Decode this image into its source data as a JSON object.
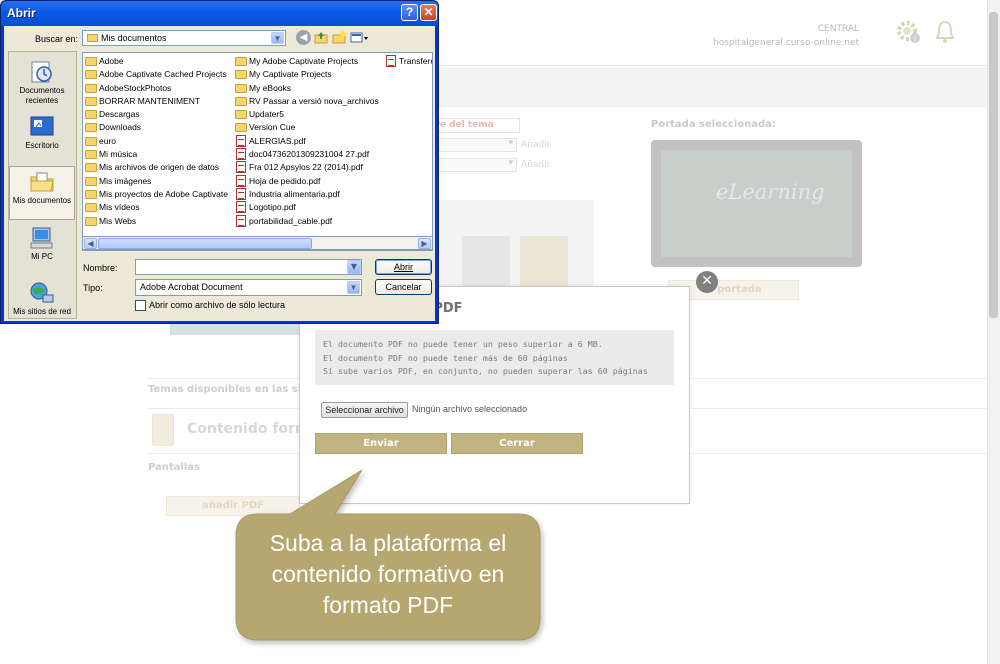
{
  "background_page": {
    "header": {
      "org": "CENTRAL",
      "url": "hospitalgeneral.curso-online.net"
    },
    "field_label_name": "bre del tema",
    "add_labels": [
      "Añadir",
      "Añadir"
    ],
    "portada_label": "Portada seleccionada:",
    "portada_image_text": "eLearning",
    "portada_button": "ir portada",
    "temas_label": "Temas disponibles en las sigui",
    "contenido_label": "Contenido forma",
    "pantallas_label": "Pantallas",
    "add_pdf_button": "añadir PDF"
  },
  "modal": {
    "title": "e PDF",
    "close_icon": "close-icon",
    "info_lines": [
      "El documento PDF no puede tener un peso superior a 6 MB.",
      "El documento PDF no puede tener más de 60 páginas",
      "Si sube varios PDF, en conjunto, no pueden superar las 60 páginas"
    ],
    "file_button": "Seleccionar archivo",
    "file_status": "Ningún archivo seleccionado",
    "submit_button": "Enviar",
    "close_button": "Cerrar",
    "accent_color": "#c2b480"
  },
  "callout": {
    "lines": [
      "Suba a la plataforma el",
      "contenido formativo en",
      "formato PDF"
    ],
    "color": "#b6a771"
  },
  "dialog": {
    "title": "Abrir",
    "help_button": "?",
    "close_button": "✕",
    "look_in_label": "Buscar en:",
    "look_in_value": "Mis documentos",
    "toolbar_icons": [
      "back-icon",
      "up-folder-icon",
      "new-folder-icon",
      "view-menu-icon"
    ],
    "places": [
      {
        "label": "Documentos recientes",
        "icon": "recent-documents-icon"
      },
      {
        "label": "Escritorio",
        "icon": "desktop-icon"
      },
      {
        "label": "Mis documentos",
        "icon": "my-documents-icon",
        "active": true
      },
      {
        "label": "Mi PC",
        "icon": "my-computer-icon"
      },
      {
        "label": "Mis sitios de red",
        "icon": "network-places-icon"
      }
    ],
    "files_col1": [
      {
        "name": "Adobe",
        "type": "folder"
      },
      {
        "name": "Adobe Captivate Cached Projects",
        "type": "folder"
      },
      {
        "name": "AdobeStockPhotos",
        "type": "folder"
      },
      {
        "name": "BORRAR MANTENIMENT",
        "type": "folder"
      },
      {
        "name": "Descargas",
        "type": "folder"
      },
      {
        "name": "Downloads",
        "type": "folder"
      },
      {
        "name": "euro",
        "type": "folder"
      },
      {
        "name": "Mi música",
        "type": "folder"
      },
      {
        "name": "Mis archivos de origen de datos",
        "type": "folder"
      },
      {
        "name": "Mis imágenes",
        "type": "folder"
      },
      {
        "name": "Mis proyectos de Adobe Captivate",
        "type": "folder"
      },
      {
        "name": "Mis vídeos",
        "type": "folder"
      },
      {
        "name": "Mis Webs",
        "type": "folder"
      }
    ],
    "files_col2": [
      {
        "name": "My Adobe Captivate Projects",
        "type": "folder"
      },
      {
        "name": "My Captivate Projects",
        "type": "folder"
      },
      {
        "name": "My eBooks",
        "type": "folder"
      },
      {
        "name": "RV Passar a versió nova_archivos",
        "type": "folder"
      },
      {
        "name": "Updater5",
        "type": "folder"
      },
      {
        "name": "Version Cue",
        "type": "folder"
      },
      {
        "name": "ALERGIAS.pdf",
        "type": "pdf"
      },
      {
        "name": "doc04736201309231004 27.pdf",
        "type": "pdf"
      },
      {
        "name": "Fra  012 Apsylos 22 (2014).pdf",
        "type": "pdf"
      },
      {
        "name": "Hoja de pedido.pdf",
        "type": "pdf"
      },
      {
        "name": "Industria alimentaria.pdf",
        "type": "pdf"
      },
      {
        "name": "Logotipo.pdf",
        "type": "pdf"
      },
      {
        "name": "portabilidad_cable.pdf",
        "type": "pdf"
      }
    ],
    "files_col3": [
      {
        "name": "Transfere",
        "type": "pdf"
      }
    ],
    "filename_label": "Nombre:",
    "filename_value": "",
    "filetype_label": "Tipo:",
    "filetype_value": "Adobe Acrobat Document",
    "open_button": "Abrir",
    "cancel_button": "Cancelar",
    "readonly_label": "Abrir como archivo de sólo lectura",
    "readonly_checked": false
  }
}
